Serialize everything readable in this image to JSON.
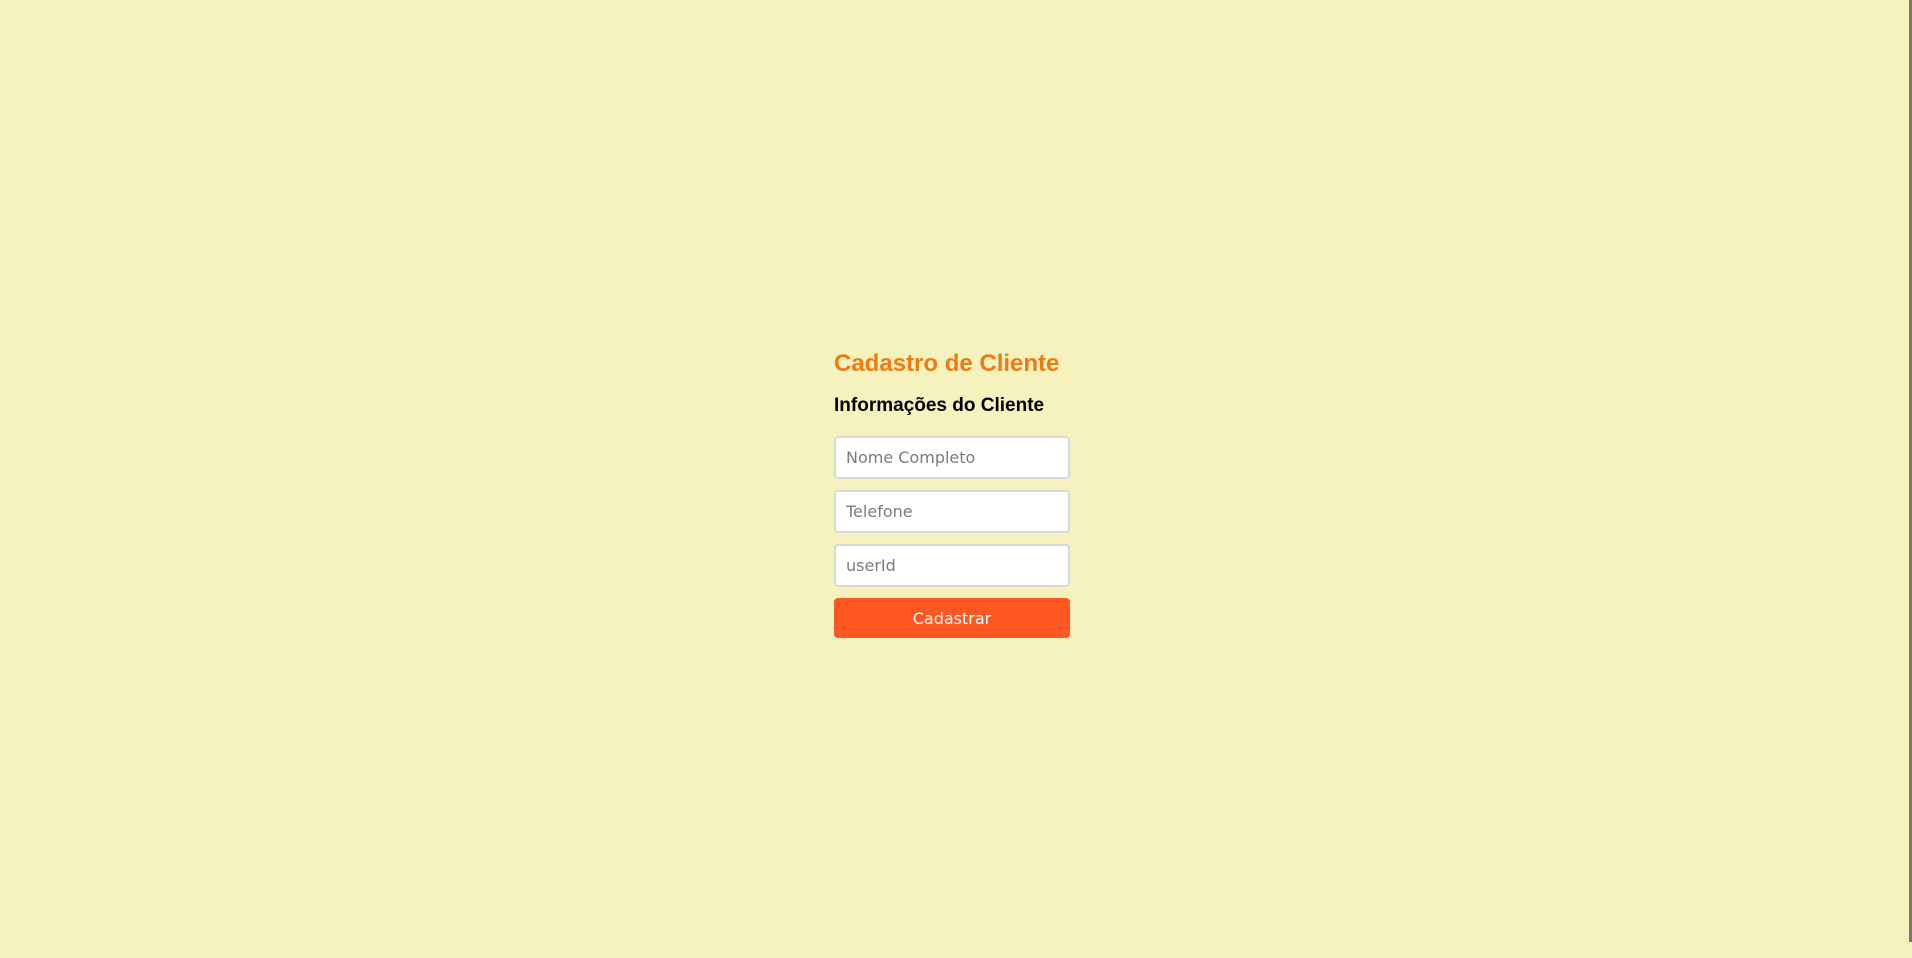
{
  "form": {
    "title": "Cadastro de Cliente",
    "section_title": "Informações do Cliente",
    "fields": [
      {
        "name": "nome-completo",
        "value": "",
        "placeholder": "Nome Completo"
      },
      {
        "name": "telefone",
        "value": "",
        "placeholder": "Telefone"
      },
      {
        "name": "userid",
        "value": "",
        "placeholder": "userId"
      }
    ],
    "submit_label": "Cadastrar"
  },
  "colors": {
    "background": "#f5f2bd",
    "title": "#ee7c13",
    "button": "#ff5722",
    "button_text": "#ffffff"
  }
}
